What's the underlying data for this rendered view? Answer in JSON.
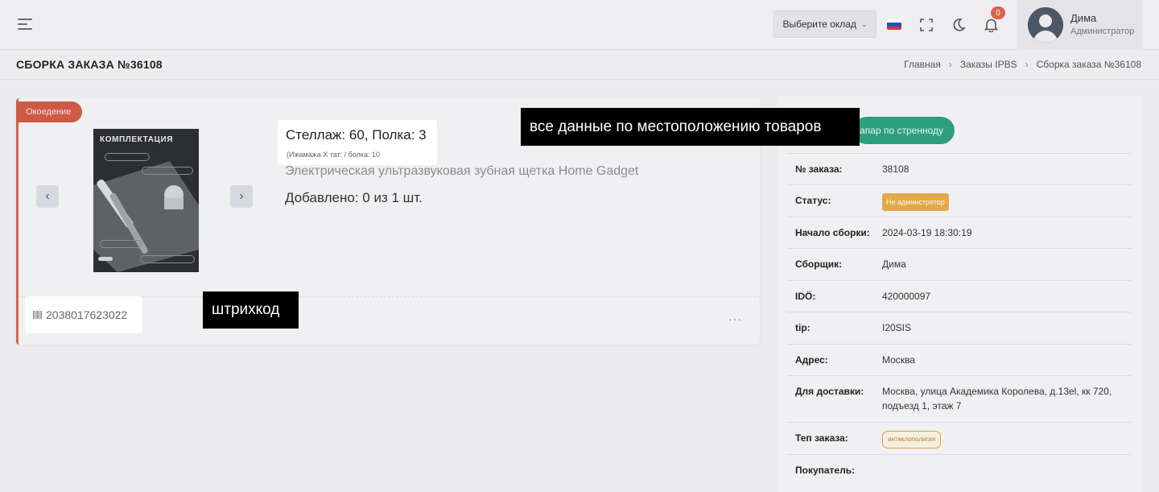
{
  "header": {
    "warehouse_select": "Выберите оклад",
    "notifications_count": "0",
    "user": {
      "name": "Дима",
      "role": "Администратор"
    }
  },
  "titlebar": {
    "title": "СБОРКА ЗАКАЗА №36108",
    "breadcrumb": [
      "Главная",
      "Заказы IPBS",
      "Сборка заказа №36108"
    ]
  },
  "product_card": {
    "status_ribbon": "Окоедение",
    "image_caption": "КОМПЛЕКТАЦИЯ",
    "location_main": "Стеллаж: 60, Полка: 3",
    "location_sub": "(Ижамажа Х тат:  / болка: 10",
    "product_name": "Электрическая ультразвуковая зубная щетка Home Gadget",
    "added": "Добавлено: 0 из 1 шт.",
    "barcode": "2038017623022",
    "more": "···"
  },
  "annotations": {
    "location_note": "все данные по местоположению товаров",
    "barcode_note": "штрихкод"
  },
  "order_panel": {
    "action_button": "тапар по стренноду",
    "rows": [
      {
        "label": "№ заказа:",
        "value": "38108"
      },
      {
        "label": "Статус:",
        "badge": "Не админстретор"
      },
      {
        "label": "Начало сборки:",
        "value": "2024-03-19 18:30:19"
      },
      {
        "label": "Сборщик:",
        "value": "Дима"
      },
      {
        "label": "IDÖ:",
        "value": "420000097"
      },
      {
        "label": "tip:",
        "value": "I20SIS"
      },
      {
        "label": "Адрес:",
        "value": "Москва"
      },
      {
        "label": "Для доставки:",
        "value": "Москва, улица Академика Королева, д.13el, кк 720, подъезд 1, этаж 7"
      },
      {
        "label": "Теп заказа:",
        "badge": "интеклополигия"
      },
      {
        "label": "Покупатель:",
        "value": ""
      }
    ]
  },
  "colors": {
    "accent_red": "#cc5a45",
    "green": "#2e9f7d",
    "status_orange": "#e3a949"
  }
}
